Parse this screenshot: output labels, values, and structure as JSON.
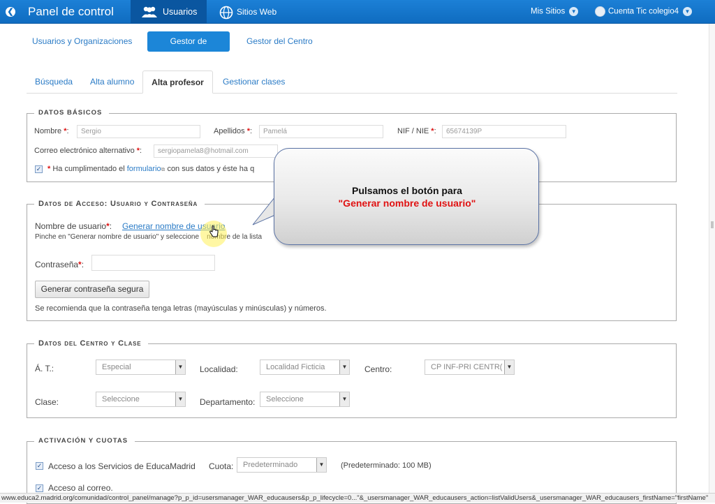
{
  "topbar": {
    "title": "Panel de control",
    "users_tab": "Usuarios",
    "sites": "Sitios Web",
    "my_sites": "Mis Sitios",
    "account": "Cuenta Tic colegio4",
    "accent": "#1270c4"
  },
  "subnav": {
    "items": [
      "Usuarios y Organizaciones",
      "Gestor de Usuarios",
      "Gestor del Centro"
    ]
  },
  "tabs": {
    "items": [
      "Búsqueda",
      "Alta alumno",
      "Alta profesor",
      "Gestionar clases"
    ]
  },
  "basic": {
    "legend": "Datos básicos",
    "nombre_label": "Nombre",
    "nombre_value": "Sergio",
    "apellidos_label": "Apellidos",
    "apellidos_value": "Pamelá",
    "nif_label": "NIF / NIE",
    "nif_value": "65674139P",
    "correo_label": "Correo electrónico alternativo",
    "correo_value": "sergiopamela8@hotmail.com",
    "form_pre": "Ha cumplimentado el",
    "form_link": "formulario",
    "form_post": "con sus datos y éste ha q"
  },
  "access": {
    "legend": "Datos de Acceso: Usuario y Contraseña",
    "usuario_label": "Nombre de usuario",
    "generar_link": "Generar nombre de usuario",
    "hint_pre": "Pinche en \"Generar nombre de usuario\" y seleccione",
    "hint_post": "nombre de la lista",
    "password_label": "Contraseña",
    "gen_pass_btn": "Generar contraseña segura",
    "recommend": "Se recomienda que la contraseña tenga letras (mayúsculas y minúsculas) y números."
  },
  "centro": {
    "legend": "Datos del Centro y Clase",
    "at_label": "Á. T.:",
    "at_value": "Especial",
    "localidad_label": "Localidad:",
    "localidad_value": "Localidad Ficticia",
    "centro_label": "Centro:",
    "centro_value": "CP INF-PRI CENTR(",
    "clase_label": "Clase:",
    "clase_value": "Seleccione",
    "depto_label": "Departamento:",
    "depto_value": "Seleccione"
  },
  "activacion": {
    "legend": "Activación y cuotas",
    "servicios": "Acceso a los Servicios de EducaMadrid",
    "cuota_label": "Cuota:",
    "cuota_value": "Predeterminado",
    "cuota_info": "(Predeterminado: 100 MB)",
    "correo": "Acceso al correo."
  },
  "callout": {
    "line1": "Pulsamos el botón para",
    "line2": "\"Generar nombre de usuario\""
  },
  "statusbar": {
    "url": "www.educa2.madrid.org/comunidad/control_panel/manage?p_p_id=usersmanager_WAR_educausers&p_p_lifecycle=0...\"&_usersmanager_WAR_educausers_action=listValidUsers&_usersmanager_WAR_educausers_firstName=\"firstName\""
  }
}
